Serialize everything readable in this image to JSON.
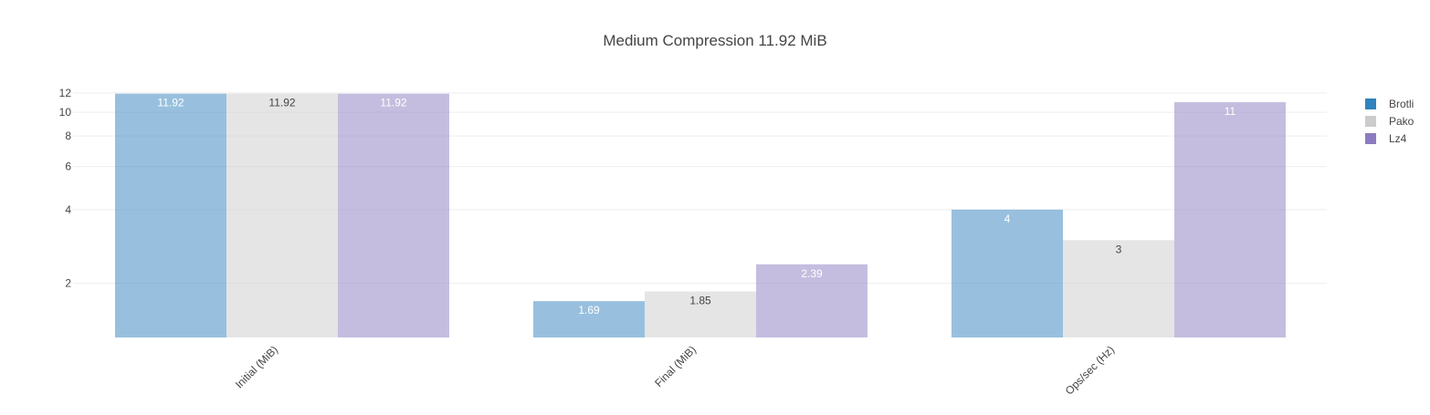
{
  "chart_data": {
    "type": "bar",
    "title": "Medium Compression 11.92 MiB",
    "xlabel": "",
    "ylabel": "",
    "yscale": "log",
    "ylim": [
      1.2,
      12.2
    ],
    "grid": true,
    "legend_position": "top-right",
    "categories": [
      "Initial (MiB)",
      "Final (MiB)",
      "Ops/sec (Hz)"
    ],
    "y_ticks": [
      2,
      4,
      6,
      8,
      10,
      12
    ],
    "series": [
      {
        "name": "Brotli",
        "color": "#3182bd",
        "values": [
          11.92,
          1.69,
          4
        ],
        "labels": [
          "11.92",
          "1.69",
          "4"
        ]
      },
      {
        "name": "Pako",
        "color": "#cccccc",
        "values": [
          11.92,
          1.85,
          3
        ],
        "labels": [
          "11.92",
          "1.85",
          "3"
        ]
      },
      {
        "name": "Lz4",
        "color": "#8c7bc0",
        "values": [
          11.92,
          2.39,
          11
        ],
        "labels": [
          "11.92",
          "2.39",
          "11"
        ]
      }
    ]
  }
}
